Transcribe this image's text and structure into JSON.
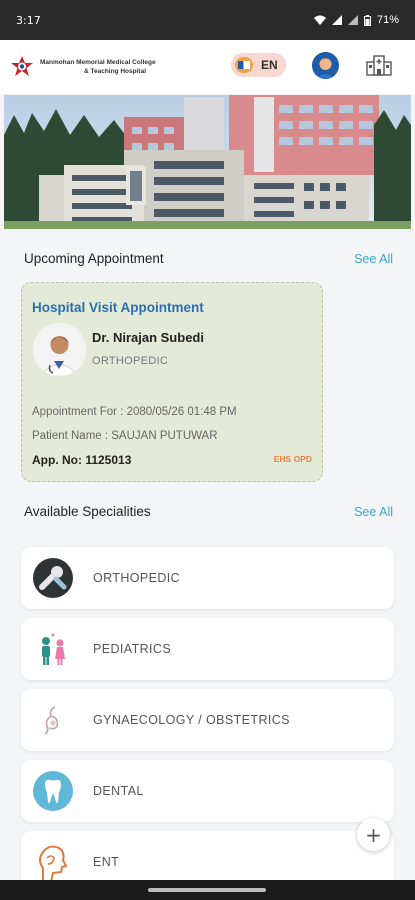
{
  "status_bar": {
    "time": "3:17",
    "battery": "71%"
  },
  "header": {
    "hospital_name_line1": "Manmohan Memorial Medical College",
    "hospital_name_line2": "& Teaching Hospital",
    "language": "EN",
    "icons": [
      "logo-mark",
      "language-flag-icon",
      "user-avatar",
      "hospital-building-icon"
    ]
  },
  "upcoming": {
    "title": "Upcoming Appointment",
    "see_all": "See All",
    "card": {
      "type": "Hospital Visit Appointment",
      "doctor_name": "Dr. Nirajan Subedi",
      "department": "ORTHOPEDIC",
      "appointment_for": "Appointment For : 2080/05/26 01:48 PM",
      "patient_name": "Patient Name : SAUJAN PUTUWAR",
      "appointment_no": "App. No: 1125013",
      "tag": "EHS OPD"
    }
  },
  "specialities": {
    "title": "Available Specialities",
    "see_all": "See All",
    "items": [
      {
        "label": "ORTHOPEDIC",
        "icon": "bone-joint-icon"
      },
      {
        "label": "PEDIATRICS",
        "icon": "children-icon"
      },
      {
        "label": "GYNAECOLOGY / OBSTETRICS",
        "icon": "pregnancy-icon"
      },
      {
        "label": "DENTAL",
        "icon": "tooth-icon"
      },
      {
        "label": "ENT",
        "icon": "ear-nose-throat-icon"
      }
    ]
  },
  "fab": {
    "label": "+"
  },
  "colors": {
    "accent": "#3aa6cf",
    "appt_title": "#2c6fae",
    "card_bg": "#e4ead8",
    "tag": "#e8833a"
  }
}
